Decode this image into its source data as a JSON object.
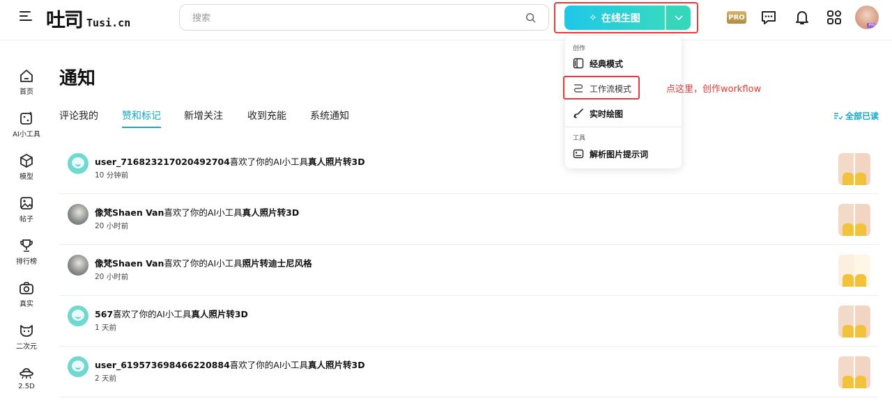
{
  "header": {
    "logo_text": "吐司",
    "logo_domain": "Tusi.cn",
    "search_placeholder": "搜索",
    "generate_label": "在线生图",
    "pro_badge": "PRO"
  },
  "sidebar": {
    "items": [
      {
        "label": "首页",
        "icon": "home-icon"
      },
      {
        "label": "AI小工具",
        "icon": "dice-icon"
      },
      {
        "label": "模型",
        "icon": "cube-icon"
      },
      {
        "label": "帖子",
        "icon": "image-icon"
      },
      {
        "label": "排行榜",
        "icon": "trophy-icon"
      },
      {
        "label": "真实",
        "icon": "camera-icon"
      },
      {
        "label": "二次元",
        "icon": "cat-icon"
      },
      {
        "label": "2.5D",
        "icon": "ufo-icon"
      }
    ]
  },
  "page": {
    "title": "通知",
    "mark_all_label": "全部已读",
    "tabs": [
      {
        "label": "评论我的"
      },
      {
        "label": "赞和标记"
      },
      {
        "label": "新增关注"
      },
      {
        "label": "收到充能"
      },
      {
        "label": "系统通知"
      }
    ],
    "active_tab": "赞和标记"
  },
  "notifications": [
    {
      "user": "user_716823217020492704",
      "action": "喜欢了你的AI小工具",
      "target": "真人照片转3D",
      "time": "10 分钟前"
    },
    {
      "user": "像梵Shaen Van",
      "action": "喜欢了你的AI小工具",
      "target": "真人照片转3D",
      "time": "20 小时前"
    },
    {
      "user": "像梵Shaen Van",
      "action": "喜欢了你的AI小工具",
      "target": "照片转迪士尼风格",
      "time": "20 小时前"
    },
    {
      "user": "567",
      "action": "喜欢了你的AI小工具",
      "target": "真人照片转3D",
      "time": "1 天前"
    },
    {
      "user": "user_619573698466220884",
      "action": "喜欢了你的AI小工具",
      "target": "真人照片转3D",
      "time": "2 天前"
    }
  ],
  "dropdown": {
    "section_create": "创作",
    "classic_mode": "经典模式",
    "workflow_mode": "工作流模式",
    "realtime_draw": "实时绘图",
    "section_tools": "工具",
    "parse_prompt": "解析图片提示词"
  },
  "annotation": "点这里，创作workflow",
  "colors": {
    "accent": "#13a9c8",
    "highlight_border": "#e83a3a",
    "annotation_text": "#e53935"
  }
}
